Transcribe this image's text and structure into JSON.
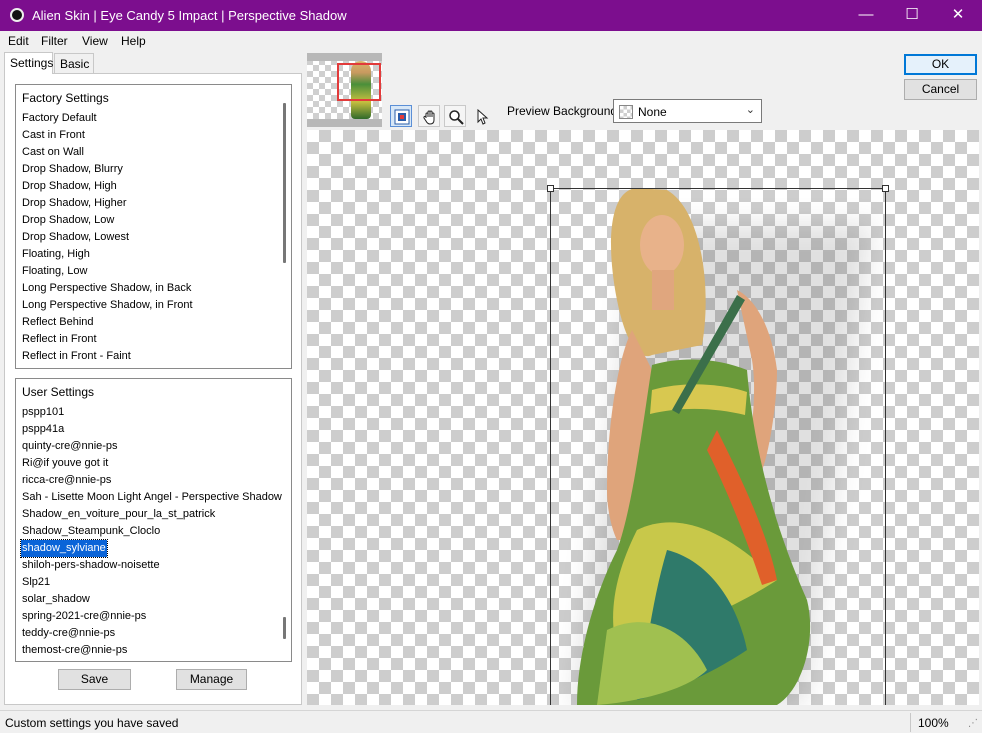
{
  "window": {
    "title": "Alien Skin | Eye Candy 5 Impact | Perspective Shadow",
    "minimize_glyph": "—",
    "maximize_glyph": "☐",
    "close_glyph": "✕"
  },
  "menu": [
    {
      "label": "Edit"
    },
    {
      "label": "Filter"
    },
    {
      "label": "View"
    },
    {
      "label": "Help"
    }
  ],
  "tabs": [
    {
      "label": "Settings",
      "active": true
    },
    {
      "label": "Basic",
      "active": false
    }
  ],
  "factory_settings": {
    "header": "Factory Settings",
    "items": [
      "Factory Default",
      "Cast in Front",
      "Cast on Wall",
      "Drop Shadow, Blurry",
      "Drop Shadow, High",
      "Drop Shadow, Higher",
      "Drop Shadow, Low",
      "Drop Shadow, Lowest",
      "Floating, High",
      "Floating, Low",
      "Long Perspective Shadow, in Back",
      "Long Perspective Shadow, in Front",
      "Reflect Behind",
      "Reflect in Front",
      "Reflect in Front - Faint"
    ]
  },
  "user_settings": {
    "header": "User Settings",
    "selected": "shadow_sylviane",
    "items": [
      "pspp101",
      "pspp41a",
      "quinty-cre@nnie-ps",
      "Ri@if youve got it",
      "ricca-cre@nnie-ps",
      "Sah - Lisette Moon Light Angel - Perspective Shadow",
      "Shadow_en_voiture_pour_la_st_patrick",
      "Shadow_Steampunk_Cloclo",
      "shadow_sylviane",
      "shiloh-pers-shadow-noisette",
      "Slp21",
      "solar_shadow",
      "spring-2021-cre@nnie-ps",
      "teddy-cre@nnie-ps",
      "themost-cre@nnie-ps"
    ]
  },
  "buttons": {
    "save": "Save",
    "manage": "Manage",
    "ok": "OK",
    "cancel": "Cancel"
  },
  "tools": [
    {
      "name": "navigate-preview-icon"
    },
    {
      "name": "hand-icon"
    },
    {
      "name": "zoom-icon"
    },
    {
      "name": "arrow-pointer-icon"
    }
  ],
  "preview_background": {
    "label": "Preview Background:",
    "value": "None"
  },
  "status": {
    "message": "Custom settings you have saved",
    "zoom": "100%"
  },
  "colors": {
    "titlebar": "#7c0e8e",
    "selection": "#0a64d8",
    "thumbnail_viewport": "#e23a3a"
  }
}
